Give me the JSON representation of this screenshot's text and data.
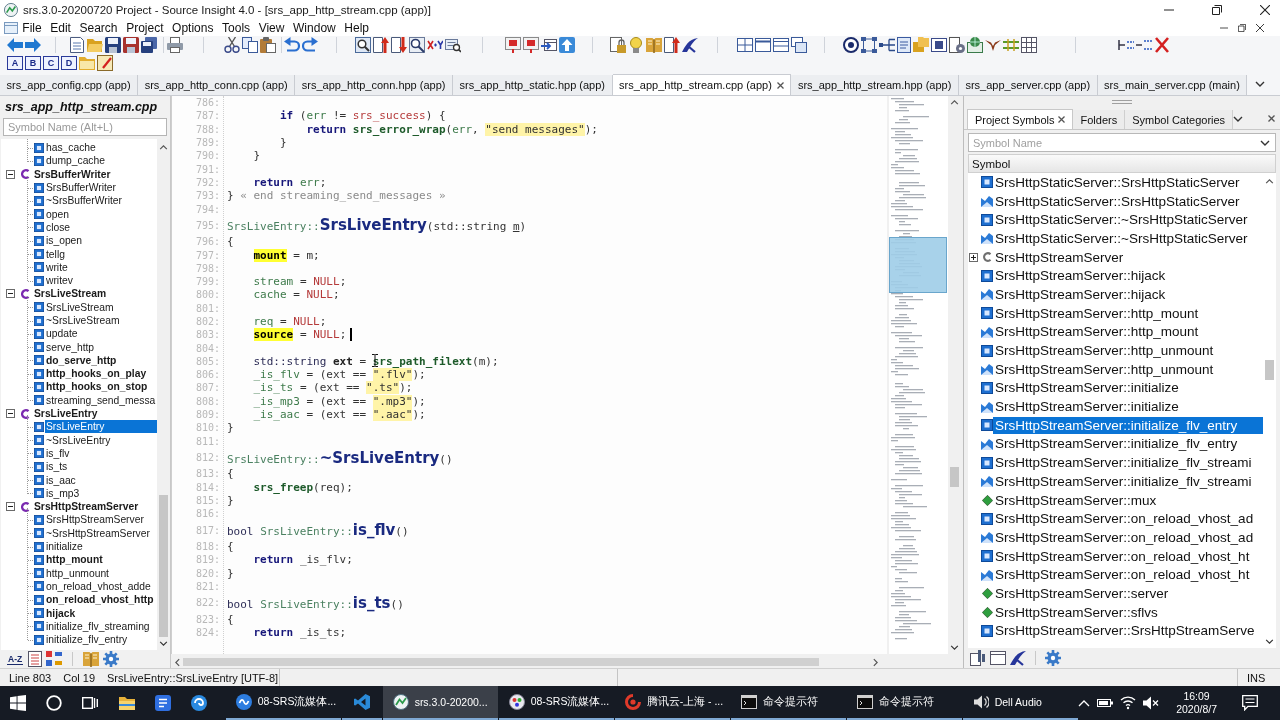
{
  "window": {
    "title": "srs.3.0-20200720 Project - Source Insight 4.0 - [srs_app_http_stream.cpp (app)]"
  },
  "menu": [
    "File",
    "Edit",
    "Search",
    "Project",
    "Options",
    "Tools",
    "View",
    "Window",
    "Help"
  ],
  "toolbar": {
    "letter_buttons": [
      "A",
      "B",
      "C",
      "D"
    ]
  },
  "tabs": [
    {
      "label": "srs_app_config.cpp (app)",
      "selected": false
    },
    {
      "label": "srs_app_http_conn.cpp (app)",
      "selected": false
    },
    {
      "label": "srs_app_http_conn.hpp (app)",
      "selected": false
    },
    {
      "label": "srs_app_http_static.hpp (app)",
      "selected": false
    },
    {
      "label": "srs_app_http_stream.cpp (app)",
      "selected": true
    },
    {
      "label": "srs_app_http_stream.hpp (app)",
      "selected": false
    },
    {
      "label": "srs_app_server.cpp (app)",
      "selected": false
    },
    {
      "label": "srs_main_server.cpp (main)",
      "selected": false
    }
  ],
  "symbol_window": {
    "title": "srs_app_http_stream.cpp",
    "search": {
      "placeholder": "Symbol Name (Alt+L)"
    },
    "sort_label": "A-Z",
    "tree": [
      {
        "children": [
          {
            "label": "has_cache",
            "bold": false,
            "selected": false
          },
          {
            "label": "dump_cache",
            "bold": false,
            "selected": false
          }
        ]
      },
      {
        "label": "SrsBufferWriter",
        "expanded": true,
        "selected": false,
        "children": [
          {
            "label": "SrsBufferWriter",
            "bold": false,
            "selected": false
          },
          {
            "label": "~SrsBufferWriter",
            "bold": false,
            "selected": false
          },
          {
            "label": "open",
            "bold": false,
            "selected": false
          },
          {
            "label": "close",
            "bold": false,
            "selected": false
          },
          {
            "label": "is_open",
            "bold": false,
            "selected": false
          },
          {
            "label": "tellg",
            "bold": false,
            "selected": false
          },
          {
            "label": "write",
            "bold": false,
            "selected": false
          },
          {
            "label": "writev",
            "bold": false,
            "selected": false
          }
        ]
      },
      {
        "label": "SrsLiveStream",
        "expanded": true,
        "selected": false,
        "children": [
          {
            "label": "SrsLiveStream",
            "bold": false,
            "selected": false
          },
          {
            "label": "~SrsLiveStream",
            "bold": false,
            "selected": false
          },
          {
            "label": "update",
            "bold": false,
            "selected": false
          },
          {
            "label": "serve_http",
            "bold": false,
            "selected": false
          },
          {
            "label": "do_serve_http",
            "bold": true,
            "selected": false
          },
          {
            "label": "http_hooks_on_play",
            "bold": true,
            "selected": false
          },
          {
            "label": "http_hooks_on_stop",
            "bold": true,
            "selected": false
          },
          {
            "label": "streaming_send_messa",
            "bold": false,
            "selected": false
          }
        ]
      },
      {
        "label": "SrsLiveEntry",
        "expanded": true,
        "selected": false,
        "children": [
          {
            "label": "SrsLiveEntry",
            "bold": false,
            "selected": true
          },
          {
            "label": "~SrsLiveEntry",
            "bold": false,
            "selected": false
          },
          {
            "label": "is_flv",
            "bold": false,
            "selected": false
          },
          {
            "label": "is_ts",
            "bold": false,
            "selected": false
          },
          {
            "label": "is_aac",
            "bold": false,
            "selected": false
          },
          {
            "label": "is_mp3",
            "bold": false,
            "selected": false
          }
        ]
      },
      {
        "label": "SrsHttpStreamServer",
        "expanded": true,
        "selected": false,
        "children": [
          {
            "label": "SrsHttpStreamServer",
            "bold": false,
            "selected": false
          },
          {
            "label": "~SrsHttpStreamServer",
            "bold": false,
            "selected": false
          },
          {
            "label": "initialize",
            "bold": false,
            "selected": false
          },
          {
            "label": "http_mount",
            "bold": true,
            "selected": false
          },
          {
            "label": "http_unmount",
            "bold": false,
            "selected": false
          },
          {
            "label": "on_reload_vhost_adde",
            "bold": false,
            "selected": false
          },
          {
            "label": "on_reload_vhost_http",
            "bold": true,
            "selected": false
          },
          {
            "label": "hijack",
            "bold": true,
            "selected": false
          },
          {
            "label": "initialize_flv_streaming",
            "bold": false,
            "selected": false
          },
          {
            "label": "initialize_flv_entry",
            "bold": false,
            "selected": false
          }
        ]
      }
    ]
  },
  "editor": {
    "lines": [
      {
        "number": "786:"
      },
      {
        "number": "787:",
        "tokens": [
          {
            "kind": "keyword",
            "text": "        if"
          },
          {
            "kind": "plain",
            "text": " ("
          },
          {
            "kind": "var",
            "text": "err"
          },
          {
            "kind": "plain",
            "text": " != "
          },
          {
            "kind": "const",
            "text": "srs_success"
          },
          {
            "kind": "plain",
            "text": ") {"
          }
        ]
      },
      {
        "number": "788:",
        "tokens": [
          {
            "kind": "keyword",
            "text": "            return "
          },
          {
            "kind": "fn",
            "text": "srs_error_wrap"
          },
          {
            "kind": "plain",
            "text": "("
          },
          {
            "kind": "var",
            "text": "err"
          },
          {
            "kind": "plain",
            "text": ", "
          },
          {
            "kind": "string",
            "text": "\"send messages\""
          },
          {
            "kind": "plain",
            "text": ");"
          }
        ]
      },
      {
        "number": "789:",
        "tokens": [
          {
            "kind": "plain",
            "text": "        }"
          }
        ]
      },
      {
        "number": "790:",
        "tokens": [
          {
            "kind": "plain",
            "text": "    }"
          }
        ]
      },
      {
        "number": "791:"
      },
      {
        "number": "792:",
        "tokens": [
          {
            "kind": "keyword",
            "text": "    return "
          },
          {
            "kind": "var",
            "text": "err"
          },
          {
            "kind": "plain",
            "text": ";"
          }
        ]
      },
      {
        "number": "793:",
        "tokens": [
          {
            "kind": "plain",
            "text": "} "
          },
          {
            "kind": "comment",
            "text": "« end streaming_send_messages »"
          }
        ]
      },
      {
        "number": "794:"
      },
      {
        "number": "795:",
        "tokens": [
          {
            "kind": "cls",
            "text": "SrsLiveEntry::"
          },
          {
            "kind": "def",
            "text": "SrsLiveEntry"
          },
          {
            "kind": "plain",
            "text": "(std::string "
          },
          {
            "kind": "param",
            "text": "m"
          },
          {
            "kind": "plain",
            "text": ")"
          }
        ]
      },
      {
        "number": "796:",
        "tokens": [
          {
            "kind": "plain",
            "text": "{"
          }
        ]
      },
      {
        "number": "797:",
        "tokens": [
          {
            "kind": "hl",
            "text": "    mount"
          },
          {
            "kind": "plain",
            "text": " = m;"
          }
        ]
      },
      {
        "number": "798:"
      },
      {
        "number": "799:",
        "tokens": [
          {
            "kind": "var",
            "text": "    stream"
          },
          {
            "kind": "plain",
            "text": " = "
          },
          {
            "kind": "const",
            "text": "NULL"
          },
          {
            "kind": "plain",
            "text": ";"
          }
        ]
      },
      {
        "number": "800:",
        "tokens": [
          {
            "kind": "var",
            "text": "    cache"
          },
          {
            "kind": "plain",
            "text": " = "
          },
          {
            "kind": "const",
            "text": "NULL"
          },
          {
            "kind": "plain",
            "text": ";"
          }
        ]
      },
      {
        "number": "801:"
      },
      {
        "number": "802:",
        "tokens": [
          {
            "kind": "var",
            "text": "    req"
          },
          {
            "kind": "plain",
            "text": " = "
          },
          {
            "kind": "const",
            "text": "NULL"
          },
          {
            "kind": "plain",
            "text": ";"
          }
        ]
      },
      {
        "number": "803:",
        "tokens": [
          {
            "kind": "hl",
            "text": "    source"
          },
          {
            "kind": "plain",
            "text": " = "
          },
          {
            "kind": "const",
            "text": "NULL"
          },
          {
            "kind": "plain",
            "text": ";"
          },
          {
            "kind": "caret"
          }
        ]
      },
      {
        "number": "804:"
      },
      {
        "number": "805:",
        "tokens": [
          {
            "kind": "type",
            "text": "    std::string "
          },
          {
            "kind": "local",
            "text": "ext"
          },
          {
            "kind": "plain",
            "text": " = "
          },
          {
            "kind": "pointer"
          },
          {
            "kind": "fn",
            "text": "srs_path_filext"
          },
          {
            "kind": "plain",
            "text": "(m);"
          }
        ]
      },
      {
        "number": "806:",
        "tokens": [
          {
            "kind": "var",
            "text": "    _is_flv"
          },
          {
            "kind": "plain",
            "text": " = (ext == "
          },
          {
            "kind": "string",
            "text": "\".flv\""
          },
          {
            "kind": "plain",
            "text": ");"
          }
        ]
      },
      {
        "number": "807:",
        "tokens": [
          {
            "kind": "var",
            "text": "    _is_ts"
          },
          {
            "kind": "plain",
            "text": " = (ext == "
          },
          {
            "kind": "string",
            "text": "\".ts\""
          },
          {
            "kind": "plain",
            "text": ");"
          }
        ]
      },
      {
        "number": "808:",
        "tokens": [
          {
            "kind": "var",
            "text": "    _is_mp3"
          },
          {
            "kind": "plain",
            "text": " = (ext == "
          },
          {
            "kind": "string",
            "text": "\".mp3\""
          },
          {
            "kind": "plain",
            "text": ");"
          }
        ]
      },
      {
        "number": "809:",
        "tokens": [
          {
            "kind": "var",
            "text": "    _is_aac"
          },
          {
            "kind": "plain",
            "text": " = (ext == "
          },
          {
            "kind": "string",
            "text": "\".aac\""
          },
          {
            "kind": "plain",
            "text": ");"
          }
        ]
      },
      {
        "number": "810:",
        "tokens": [
          {
            "kind": "plain",
            "text": "}"
          }
        ]
      },
      {
        "number": "811:"
      },
      {
        "number": "812:",
        "tokens": [
          {
            "kind": "cls",
            "text": "SrsLiveEntry::"
          },
          {
            "kind": "def",
            "text": "~SrsLiveEntry"
          },
          {
            "kind": "plain",
            "text": "()"
          }
        ]
      },
      {
        "number": "813:",
        "tokens": [
          {
            "kind": "plain",
            "text": "{"
          }
        ]
      },
      {
        "number": "814:",
        "tokens": [
          {
            "kind": "fn",
            "text": "    srs_freep"
          },
          {
            "kind": "plain",
            "text": "(req);"
          }
        ]
      },
      {
        "number": "815:",
        "tokens": [
          {
            "kind": "plain",
            "text": "}"
          }
        ]
      },
      {
        "number": "816:"
      },
      {
        "number": "817:",
        "tokens": [
          {
            "kind": "type",
            "text": "bool "
          },
          {
            "kind": "cls",
            "text": "SrsLiveEntry::"
          },
          {
            "kind": "def",
            "text": "is_flv"
          },
          {
            "kind": "plain",
            "text": "()"
          }
        ]
      },
      {
        "number": "818:",
        "tokens": [
          {
            "kind": "plain",
            "text": "{"
          }
        ]
      },
      {
        "number": "819:",
        "tokens": [
          {
            "kind": "keyword",
            "text": "    return "
          },
          {
            "kind": "plain",
            "text": "_is_flv;"
          }
        ]
      },
      {
        "number": "820:",
        "tokens": [
          {
            "kind": "plain",
            "text": "}"
          }
        ]
      },
      {
        "number": "821:"
      },
      {
        "number": "822:",
        "tokens": [
          {
            "kind": "type",
            "text": "bool "
          },
          {
            "kind": "cls",
            "text": "SrsLiveEntry::"
          },
          {
            "kind": "def",
            "text": "is_ts"
          },
          {
            "kind": "plain",
            "text": "()"
          }
        ]
      },
      {
        "number": "823:",
        "tokens": [
          {
            "kind": "plain",
            "text": "{"
          }
        ]
      },
      {
        "number": "824:",
        "tokens": [
          {
            "kind": "keyword",
            "text": "    return "
          },
          {
            "kind": "plain",
            "text": "_is_ts;"
          }
        ]
      }
    ]
  },
  "project_window": {
    "tabs": [
      {
        "label": "Project Symbols",
        "selected": true
      },
      {
        "label": "Folders",
        "selected": false
      },
      {
        "label": "Symbol Categories",
        "selected": false
      }
    ],
    "search": {
      "placeholder": "Symbol Name"
    },
    "column": "Symbol",
    "symbols": [
      {
        "kind": "function",
        "label": "SrsHttpStaticServer::SrsHttpStaticServer",
        "selected": false
      },
      {
        "kind": "prototype",
        "label": "SrsHttpStaticServer::SrsHttpStaticServer",
        "selected": false
      },
      {
        "kind": "function",
        "label": "SrsHttpStaticServer::~SrsHttpStaticServer",
        "selected": false
      },
      {
        "kind": "prototype",
        "label": "SrsHttpStaticServer::~SrsHttpStaticServer",
        "selected": false
      },
      {
        "kind": "class",
        "label": "SrsHttpStreamServer",
        "selected": false,
        "expanded": false
      },
      {
        "kind": "function",
        "label": "SrsHttpStreamServer::hijack",
        "selected": false
      },
      {
        "kind": "prototype",
        "label": "SrsHttpStreamServer::hijack",
        "selected": false
      },
      {
        "kind": "function",
        "label": "SrsHttpStreamServer::http_mount",
        "selected": false
      },
      {
        "kind": "prototype",
        "label": "SrsHttpStreamServer::http_mount",
        "selected": false
      },
      {
        "kind": "function",
        "label": "SrsHttpStreamServer::http_unmount",
        "selected": false
      },
      {
        "kind": "prototype",
        "label": "SrsHttpStreamServer::http_unmount",
        "selected": false
      },
      {
        "kind": "function",
        "label": "SrsHttpStreamServer::initialize",
        "selected": false
      },
      {
        "kind": "prototype",
        "label": "SrsHttpStreamServer::initialize",
        "selected": false
      },
      {
        "kind": "function",
        "label": "SrsHttpStreamServer::initialize_flv_entry",
        "selected": true
      },
      {
        "kind": "prototype",
        "label": "SrsHttpStreamServer::initialize_flv_entry",
        "selected": false
      },
      {
        "kind": "function",
        "label": "SrsHttpStreamServer::initialize_flv_streami",
        "selected": false
      },
      {
        "kind": "prototype",
        "label": "SrsHttpStreamServer::initialize_flv_streami",
        "selected": false
      },
      {
        "kind": "variable",
        "label": "SrsHttpStreamServer::mux",
        "selected": false
      },
      {
        "kind": "function",
        "label": "SrsHttpStreamServer::on_reload_vhost_ad",
        "selected": false
      },
      {
        "kind": "prototype",
        "label": "SrsHttpStreamServer::on_reload_vhost_ad",
        "selected": false
      },
      {
        "kind": "function",
        "label": "SrsHttpStreamServer::on_reload_vhost_ht",
        "selected": false
      },
      {
        "kind": "prototype",
        "label": "SrsHttpStreamServer::on_reload_vhost_ht",
        "selected": false
      },
      {
        "kind": "variable",
        "label": "SrsHttpStreamServer::server",
        "selected": false
      },
      {
        "kind": "variable",
        "label": "SrsHttpStreamServer::sflvs",
        "selected": false
      },
      {
        "kind": "function",
        "label": "SrsHttpStreamServer::SrsHttpStreamServe",
        "selected": false
      }
    ]
  },
  "status_bar": {
    "fields": [
      "Line 803",
      "Col 19",
      "SrsLiveEntry::SrsLiveEntry [UTF-8]"
    ],
    "mode": "INS"
  },
  "taskbar": {
    "apps": [
      {
        "label": "08-SRS流媒体...",
        "selected": false
      },
      {
        "selected": false
      },
      {
        "label": "srs.3.0-20200...",
        "selected": true
      },
      {
        "label": "08-SRS流媒体...",
        "selected": false
      },
      {
        "label": "腾讯云-上海 - ...",
        "selected": false
      },
      {
        "label": "命令提示符",
        "selected": false
      },
      {
        "label": "命令提示符",
        "selected": false
      },
      {
        "label": "Dell Audio",
        "selected": false
      }
    ],
    "time": "16:09",
    "date": "2020/8/7"
  }
}
